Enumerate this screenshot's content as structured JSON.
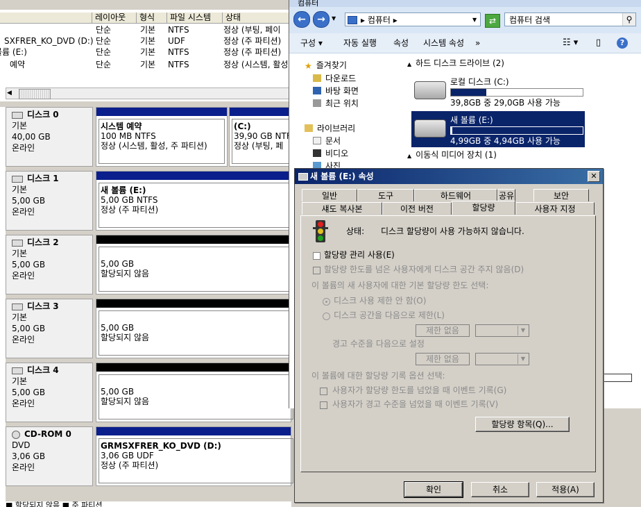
{
  "disk_mgmt": {
    "columns": [
      "레이아웃",
      "형식",
      "파일 시스템",
      "상태"
    ],
    "volumes": [
      {
        "name": "SXFRER_KO_DVD (D:)",
        "layout": "단순",
        "type": "기본",
        "fs": "UDF",
        "status": "정상 (주 파티션)"
      },
      {
        "name": "볼륨 (E:)",
        "layout": "단순",
        "type": "기본",
        "fs": "NTFS",
        "status": "정상 (주 파티션)"
      },
      {
        "name": "예약",
        "layout": "단순",
        "type": "기본",
        "fs": "NTFS",
        "status": "정상 (시스템, 활성"
      }
    ],
    "volume_partial_top": {
      "name": "",
      "layout": "단순",
      "type": "기본",
      "fs": "NTFS",
      "status": "정상 (부팅, 페이"
    },
    "disks": [
      {
        "name": "디스크 0",
        "type": "기본",
        "size": "40,00 GB",
        "state": "온라인",
        "parts": [
          {
            "name": "시스템 예약",
            "size_fs": "100 MB NTFS",
            "status": "정상 (시스템, 활성, 주 파티션)"
          },
          {
            "name": "(C:)",
            "size_fs": "39,90 GB NTF",
            "status": "정상 (부팅, 페"
          }
        ]
      },
      {
        "name": "디스크 1",
        "type": "기본",
        "size": "5,00 GB",
        "state": "온라인",
        "parts": [
          {
            "name": "새 볼륨  (E:)",
            "size_fs": "5,00 GB NTFS",
            "status": "정상 (주 파티션)"
          }
        ]
      },
      {
        "name": "디스크 2",
        "type": "기본",
        "size": "5,00 GB",
        "state": "온라인",
        "parts": [
          {
            "name": "",
            "size_fs": "5,00 GB",
            "status": "할당되지 않음"
          }
        ]
      },
      {
        "name": "디스크 3",
        "type": "기본",
        "size": "5,00 GB",
        "state": "온라인",
        "parts": [
          {
            "name": "",
            "size_fs": "5,00 GB",
            "status": "할당되지 않음"
          }
        ]
      },
      {
        "name": "디스크 4",
        "type": "기본",
        "size": "5,00 GB",
        "state": "온라인",
        "parts": [
          {
            "name": "",
            "size_fs": "5,00 GB",
            "status": "할당되지 않음"
          }
        ]
      },
      {
        "name": "CD-ROM 0",
        "type": "DVD",
        "size": "3,06 GB",
        "state": "온라인",
        "parts": [
          {
            "name": "GRMSXFRER_KO_DVD  (D:)",
            "size_fs": "3,06 GB UDF",
            "status": "정상 (주 파티션)"
          }
        ]
      }
    ],
    "legend": "■ 할당되지 않음  ■ 주 파티션"
  },
  "explorer": {
    "title": "컴퓨터",
    "address": "▸ 컴퓨터 ▸",
    "search_placeholder": "컴퓨터 검색",
    "toolbar": [
      "구성 ▾",
      "자동 실행",
      "속성",
      "시스템 속성",
      "»"
    ],
    "nav": {
      "favorites": "즐겨찾기",
      "fav_items": [
        "다운로드",
        "바탕 화면",
        "최근 위치"
      ],
      "libraries": "라이브러리",
      "lib_items": [
        "문서",
        "비디오",
        "사진"
      ]
    },
    "groups": {
      "hdd": "하드 디스크 드라이브 (2)",
      "removable": "이동식 미디어 장치 (1)"
    },
    "drives": [
      {
        "name": "로컬 디스크 (C:)",
        "info": "39,8GB 중 29,0GB 사용 가능",
        "used_fraction": 0.27,
        "selected": false
      },
      {
        "name": "새 볼륨 (E:)",
        "info": "4,99GB 중 4,94GB 사용 가능",
        "used_fraction": 0.01,
        "selected": true
      }
    ]
  },
  "dialog": {
    "title": "새 볼륨 (E:) 속성",
    "tabs_row1": [
      "일반",
      "도구",
      "하드웨어",
      "공유",
      "보안"
    ],
    "tabs_row2": [
      "섀도 복사본",
      "이전 버전",
      "할당량",
      "사용자 지정"
    ],
    "active_tab": "할당량",
    "status_label": "상태:",
    "status_text": "디스크 할당량이 사용 가능하지 않습니다.",
    "enable_quota": "할당량 관리 사용(E)",
    "deny_space": "할당량 한도를 넘은 사용자에게 디스크 공간 주지 않음(D)",
    "default_limit_label": "이 볼륨의 새 사용자에 대한 기본 할당량 한도 선택:",
    "no_limit": "디스크 사용 제한 안 함(O)",
    "limit_to": "디스크 공간을 다음으로 제한(L)",
    "no_limit_value": "제한 없음",
    "warning_label": "경고 수준을 다음으로 설정",
    "warning_value": "제한 없음",
    "logging_label": "이 볼륨에 대한 할당량 기록 옵션 선택:",
    "log_exceed": "사용자가 할당량 한도를 넘었을 때 이벤트 기록(G)",
    "log_warning": "사용자가 경고 수준을 넘었을 때 이벤트 기록(V)",
    "entries_button": "할당량 항목(Q)...",
    "ok": "확인",
    "cancel": "취소",
    "apply": "적용(A)"
  }
}
